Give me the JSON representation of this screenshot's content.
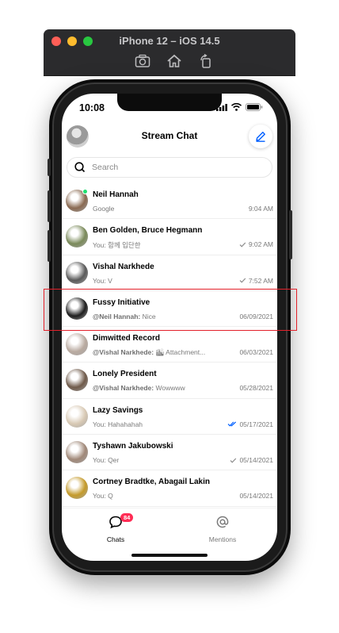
{
  "simulator": {
    "title": "iPhone 12 – iOS 14.5"
  },
  "status_bar": {
    "time": "10:08"
  },
  "header": {
    "title": "Stream Chat"
  },
  "search": {
    "placeholder": "Search"
  },
  "channels": [
    {
      "name": "Neil Hannah",
      "prefix": "",
      "message": "Google",
      "time": "9:04 AM",
      "receipt": "none",
      "online": true,
      "avatar_color": "#8a6a52"
    },
    {
      "name": "Ben Golden, Bruce Hegmann",
      "prefix": "",
      "message": "You: 함께 입단한",
      "time": "9:02 AM",
      "receipt": "sent",
      "online": false,
      "avatar_color": "#7a8a5a"
    },
    {
      "name": "Vishal Narkhede",
      "prefix": "",
      "message": "You: V",
      "time": "7:52 AM",
      "receipt": "sent",
      "online": false,
      "avatar_color": "#5a5a5a"
    },
    {
      "name": "Fussy Initiative",
      "prefix": "@Neil Hannah:",
      "message": " Nice",
      "time": "06/09/2021",
      "receipt": "none",
      "online": false,
      "avatar_color": "#1e1e1e"
    },
    {
      "name": "Dimwitted Record",
      "prefix": "@Vishal Narkhede:",
      "message": " 🏙 Attachment...",
      "time": "06/03/2021",
      "receipt": "none",
      "online": false,
      "avatar_color": "#b9aaa0"
    },
    {
      "name": "Lonely President",
      "prefix": "@Vishal Narkhede:",
      "message": " Wowwww",
      "time": "05/28/2021",
      "receipt": "none",
      "online": false,
      "avatar_color": "#6f5a4a"
    },
    {
      "name": "Lazy Savings",
      "prefix": "",
      "message": "You: Hahahahah",
      "time": "05/17/2021",
      "receipt": "read",
      "online": false,
      "avatar_color": "#d8c9b4"
    },
    {
      "name": "Tyshawn Jakubowski",
      "prefix": "",
      "message": "You: Qer",
      "time": "05/14/2021",
      "receipt": "sent",
      "online": false,
      "avatar_color": "#a08878"
    },
    {
      "name": "Cortney Bradtke, Abagail Lakin",
      "prefix": "",
      "message": "You: Q",
      "time": "05/14/2021",
      "receipt": "none",
      "online": false,
      "avatar_color": "#c49a2a"
    }
  ],
  "tabbar": {
    "chats_label": "Chats",
    "chats_badge": "84",
    "mentions_label": "Mentions"
  },
  "colors": {
    "accent": "#005fff",
    "online": "#20e070",
    "badge": "#ff2d55",
    "highlight": "#e3202a"
  }
}
